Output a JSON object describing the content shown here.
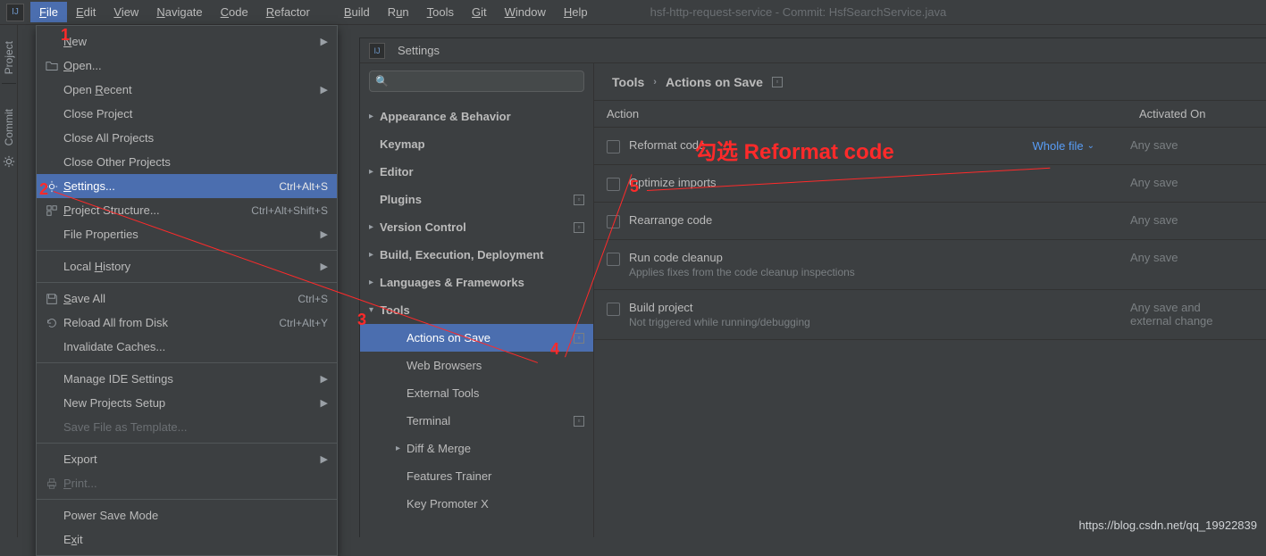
{
  "menubar": {
    "items": [
      {
        "label": "File",
        "mn": "F",
        "active": true
      },
      {
        "label": "Edit",
        "mn": "E"
      },
      {
        "label": "View",
        "mn": "V"
      },
      {
        "label": "Navigate",
        "mn": "N"
      },
      {
        "label": "Code",
        "mn": "C"
      },
      {
        "label": "Refactor",
        "mn": "R"
      },
      {
        "label": "Build",
        "mn": "B"
      },
      {
        "label": "Run",
        "mn": "u",
        "pre": "R"
      },
      {
        "label": "Tools",
        "mn": "T"
      },
      {
        "label": "Git",
        "mn": "G"
      },
      {
        "label": "Window",
        "mn": "W"
      },
      {
        "label": "Help",
        "mn": "H"
      }
    ],
    "title": "hsf-http-request-service - Commit: HsfSearchService.java"
  },
  "toolstripe": {
    "project": "Project",
    "commit": "Commit"
  },
  "file_menu": {
    "rows": [
      {
        "type": "item",
        "label": "New",
        "mn": "N",
        "arrow": true
      },
      {
        "type": "item",
        "label": "Open...",
        "mn": "O",
        "icon": "folder-icon"
      },
      {
        "type": "item",
        "label": "Open Recent",
        "mn": "R",
        "pre": "Open ",
        "arrow": true
      },
      {
        "type": "item",
        "label": "Close Project"
      },
      {
        "type": "item",
        "label": "Close All Projects"
      },
      {
        "type": "item",
        "label": "Close Other Projects"
      },
      {
        "type": "item",
        "label": "Settings...",
        "mn": "S",
        "shortcut": "Ctrl+Alt+S",
        "icon": "gear-icon",
        "selected": true
      },
      {
        "type": "item",
        "label": "Project Structure...",
        "mn": "P",
        "shortcut": "Ctrl+Alt+Shift+S",
        "icon": "structure-icon"
      },
      {
        "type": "item",
        "label": "File Properties",
        "arrow": true
      },
      {
        "type": "sep"
      },
      {
        "type": "item",
        "label": "Local History",
        "mn": "H",
        "pre": "Local ",
        "arrow": true
      },
      {
        "type": "sep"
      },
      {
        "type": "item",
        "label": "Save All",
        "mn": "S",
        "shortcut": "Ctrl+S",
        "icon": "save-icon"
      },
      {
        "type": "item",
        "label": "Reload All from Disk",
        "shortcut": "Ctrl+Alt+Y",
        "icon": "reload-icon"
      },
      {
        "type": "item",
        "label": "Invalidate Caches..."
      },
      {
        "type": "sep"
      },
      {
        "type": "item",
        "label": "Manage IDE Settings",
        "arrow": true
      },
      {
        "type": "item",
        "label": "New Projects Setup",
        "arrow": true
      },
      {
        "type": "item",
        "label": "Save File as Template...",
        "disabled": true
      },
      {
        "type": "sep"
      },
      {
        "type": "item",
        "label": "Export",
        "arrow": true
      },
      {
        "type": "item",
        "label": "Print...",
        "mn": "P",
        "icon": "print-icon",
        "disabled": true
      },
      {
        "type": "sep"
      },
      {
        "type": "item",
        "label": "Power Save Mode"
      },
      {
        "type": "item",
        "label": "Exit",
        "mn": "x",
        "pre": "E"
      }
    ]
  },
  "settings": {
    "title": "Settings",
    "tree": [
      {
        "label": "Appearance & Behavior",
        "chev": true
      },
      {
        "label": "Keymap"
      },
      {
        "label": "Editor",
        "chev": true
      },
      {
        "label": "Plugins",
        "flag": true
      },
      {
        "label": "Version Control",
        "chev": true,
        "flag": true
      },
      {
        "label": "Build, Execution, Deployment",
        "chev": true
      },
      {
        "label": "Languages & Frameworks",
        "chev": true
      },
      {
        "label": "Tools",
        "chev": true,
        "expanded": true
      },
      {
        "label": "Actions on Save",
        "child": true,
        "selected": true,
        "flag": true
      },
      {
        "label": "Web Browsers",
        "child": true
      },
      {
        "label": "External Tools",
        "child": true
      },
      {
        "label": "Terminal",
        "child": true,
        "flag": true
      },
      {
        "label": "Diff & Merge",
        "child": true,
        "chev": true
      },
      {
        "label": "Features Trainer",
        "child": true
      },
      {
        "label": "Key Promoter X",
        "child": true
      }
    ],
    "breadcrumb": {
      "root": "Tools",
      "leaf": "Actions on Save"
    },
    "columns": {
      "action": "Action",
      "activated": "Activated On"
    },
    "actions": [
      {
        "label": "Reformat code",
        "option": "Whole file",
        "activated": "Any save"
      },
      {
        "label": "Optimize imports",
        "activated": "Any save"
      },
      {
        "label": "Rearrange code",
        "activated": "Any save"
      },
      {
        "label": "Run code cleanup",
        "sub": "Applies fixes from the code cleanup inspections",
        "activated": "Any save"
      },
      {
        "label": "Build project",
        "sub": "Not triggered while running/debugging",
        "activated": "Any save and external change"
      }
    ]
  },
  "annotations": {
    "n1": "1",
    "n2": "2",
    "n3": "3",
    "n4": "4",
    "n5": "5",
    "text": "勾选 Reformat code"
  },
  "footer_url": "https://blog.csdn.net/qq_19922839"
}
